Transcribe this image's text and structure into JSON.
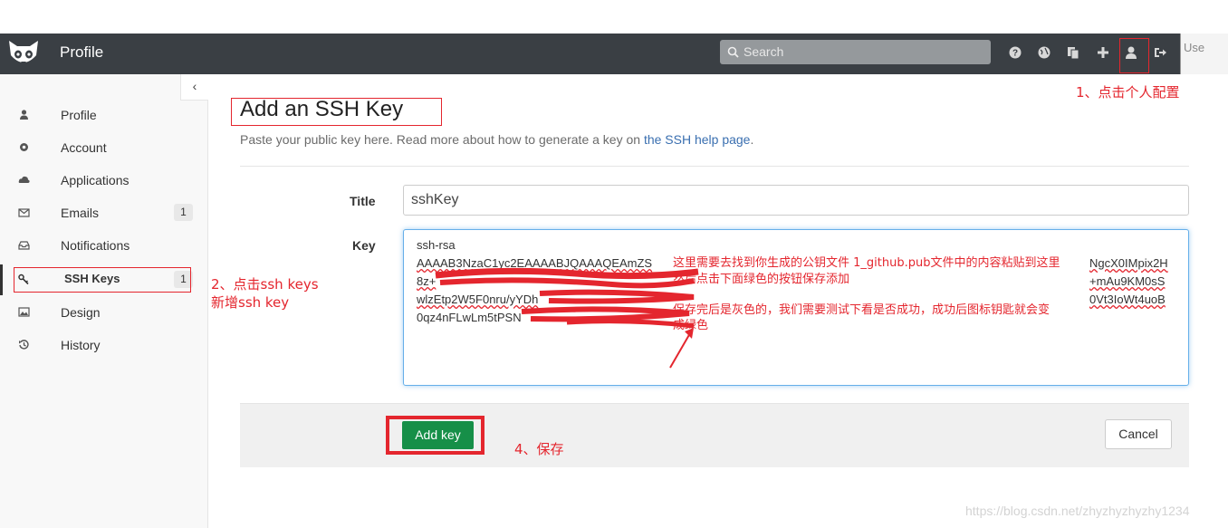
{
  "navbar": {
    "title": "Profile",
    "search_placeholder": "Search",
    "avatar_alt": "Use",
    "colors": {
      "bar": "#3a3f44",
      "search": "#95999c"
    }
  },
  "sidebar": {
    "items": [
      {
        "label": "Profile",
        "icon": "user-icon"
      },
      {
        "label": "Account",
        "icon": "gear-icon"
      },
      {
        "label": "Applications",
        "icon": "cloud-icon"
      },
      {
        "label": "Emails",
        "icon": "envelope-icon",
        "badge": "1"
      },
      {
        "label": "Notifications",
        "icon": "inbox-icon"
      },
      {
        "label": "SSH Keys",
        "icon": "key-icon",
        "badge": "1",
        "active": true
      },
      {
        "label": "Design",
        "icon": "image-icon"
      },
      {
        "label": "History",
        "icon": "history-icon"
      }
    ]
  },
  "main": {
    "title": "Add an SSH Key",
    "subtitle_prefix": "Paste your public key here. Read more about how to generate a key on ",
    "subtitle_link": "the SSH help page",
    "subtitle_suffix": ".",
    "title_label": "Title",
    "title_value": "sshKey",
    "key_label": "Key",
    "key_lines": [
      "ssh-rsa",
      "AAAAB3NzaC1yc2EAAAABJQAAAQEAmZS",
      "8z+",
      "wlzEtp2W5F0nru/yYDh",
      "0qz4nFLwLm5tPSN"
    ],
    "key_right_lines": [
      "NgcX0IMpix2H",
      "+mAu9KM0sS",
      "0Vt3IoWt4uoB"
    ],
    "add_button": "Add key",
    "cancel_button": "Cancel"
  },
  "annotations": {
    "step1": "1、点击个人配置",
    "step2_line1": "2、点击ssh keys",
    "step2_line2": "新增ssh key",
    "step4": "4、保存",
    "key_note_line1": "这里需要去找到你生成的公钥文件 1_github.pub文件中的内容粘贴到这里",
    "key_note_line2": "然后点击下面绿色的按钮保存添加",
    "key_note_line3": "保存完后是灰色的，我们需要测试下看是否成功，成功后图标钥匙就会变",
    "key_note_line4": "成绿色",
    "color": "#e4262e"
  },
  "watermark": "https://blog.csdn.net/zhyzhyzhyzhy1234"
}
